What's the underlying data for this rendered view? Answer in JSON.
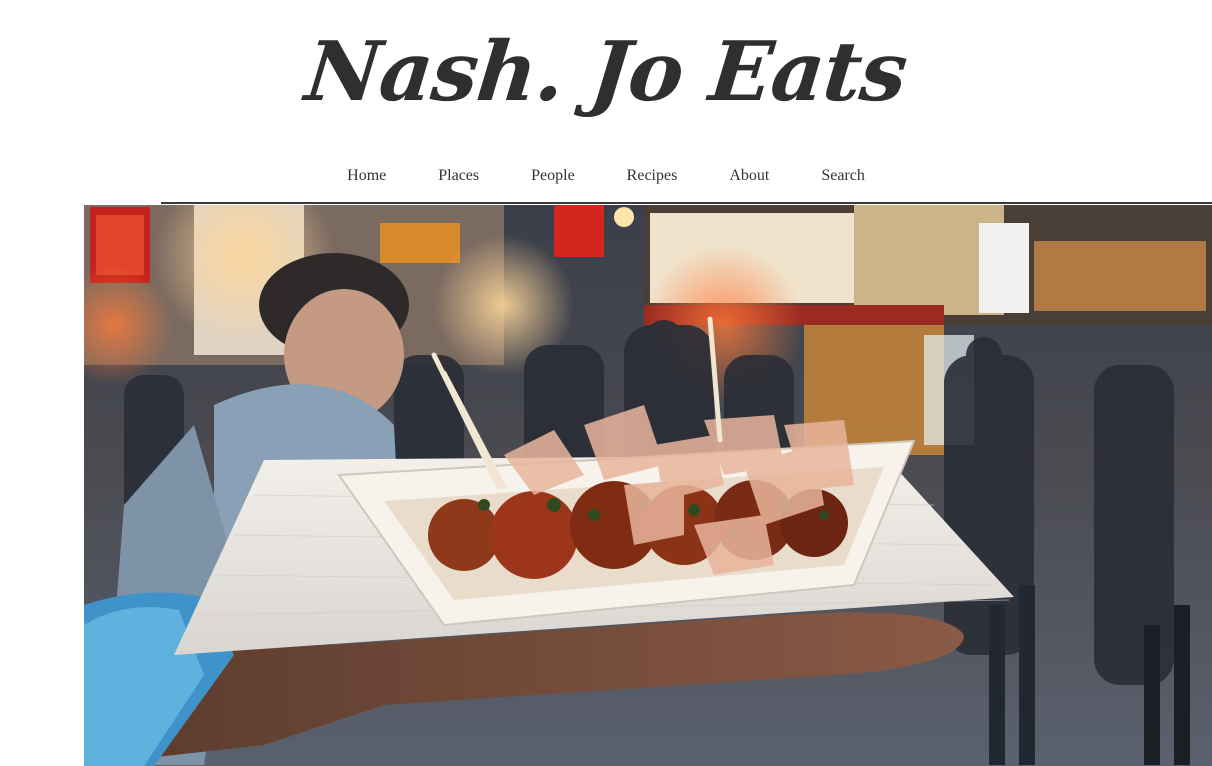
{
  "site": {
    "title": "Nash. Jo Eats"
  },
  "nav": {
    "items": [
      {
        "label": "Home"
      },
      {
        "label": "Places"
      },
      {
        "label": "People"
      },
      {
        "label": "Recipes"
      },
      {
        "label": "About"
      },
      {
        "label": "Search"
      }
    ]
  },
  "hero": {
    "description_icon": "hero-photo"
  },
  "colors": {
    "title": "#2f2f2f",
    "nav_text": "#333333",
    "rule": "#3a3a3a"
  }
}
